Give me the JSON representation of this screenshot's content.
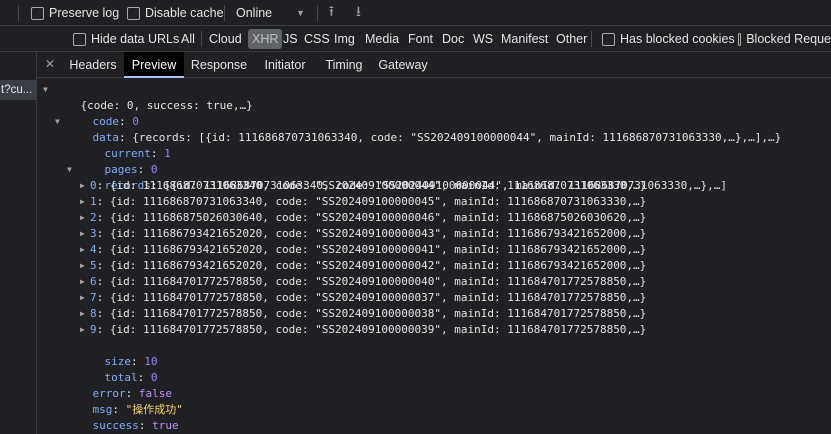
{
  "toolbar": {
    "preserve_log": "Preserve log",
    "disable_cache": "Disable cache",
    "throttle": "Online"
  },
  "filters": {
    "hide_data_urls": "Hide data URLs",
    "types": [
      "All",
      "Cloud",
      "XHR",
      "JS",
      "CSS",
      "Img",
      "Media",
      "Font",
      "Doc",
      "WS",
      "Manifest",
      "Other"
    ],
    "active_type": "XHR",
    "blocked_cookies": "Has blocked cookies",
    "blocked_requests": "Blocked Reque"
  },
  "request_list": {
    "selected_name": "t?cu..."
  },
  "detail_tabs": [
    "Headers",
    "Preview",
    "Response",
    "Initiator",
    "Timing",
    "Gateway"
  ],
  "selected_tab": "Preview",
  "preview": {
    "root_summary": "{code: 0, success: true,…}",
    "code": {
      "key": "code",
      "value": "0"
    },
    "data": {
      "key": "data",
      "summary": "{records: [{id: 111686870731063340, code: \"SS202409100000044\", mainId: 111686870731063330,…},…],…}",
      "current": {
        "key": "current",
        "value": "1"
      },
      "pages": {
        "key": "pages",
        "value": "0"
      },
      "records": {
        "key": "records",
        "summary": "[{id: 111686870731063340, code: \"SS202409100000044\", mainId: 111686870731063330,…},…]",
        "items": [
          {
            "index": "0",
            "text": "{id: 111686870731063340, code: \"SS202409100000044\", mainId: 111686870731063330,…}"
          },
          {
            "index": "1",
            "text": "{id: 111686870731063340, code: \"SS202409100000045\", mainId: 111686870731063330,…}"
          },
          {
            "index": "2",
            "text": "{id: 111686875026030640, code: \"SS202409100000046\", mainId: 111686875026030620,…}"
          },
          {
            "index": "3",
            "text": "{id: 111686793421652020, code: \"SS202409100000043\", mainId: 111686793421652000,…}"
          },
          {
            "index": "4",
            "text": "{id: 111686793421652020, code: \"SS202409100000041\", mainId: 111686793421652000,…}"
          },
          {
            "index": "5",
            "text": "{id: 111686793421652020, code: \"SS202409100000042\", mainId: 111686793421652000,…}"
          },
          {
            "index": "6",
            "text": "{id: 111684701772578850, code: \"SS202409100000040\", mainId: 111684701772578850,…}"
          },
          {
            "index": "7",
            "text": "{id: 111684701772578850, code: \"SS202409100000037\", mainId: 111684701772578850,…}"
          },
          {
            "index": "8",
            "text": "{id: 111684701772578850, code: \"SS202409100000038\", mainId: 111684701772578850,…}"
          },
          {
            "index": "9",
            "text": "{id: 111684701772578850, code: \"SS202409100000039\", mainId: 111684701772578850,…}"
          }
        ]
      },
      "size": {
        "key": "size",
        "value": "10"
      },
      "total": {
        "key": "total",
        "value": "0"
      }
    },
    "error": {
      "key": "error",
      "value": "false"
    },
    "msg": {
      "key": "msg",
      "value": "\"操作成功\""
    },
    "success": {
      "key": "success",
      "value": "true"
    }
  }
}
